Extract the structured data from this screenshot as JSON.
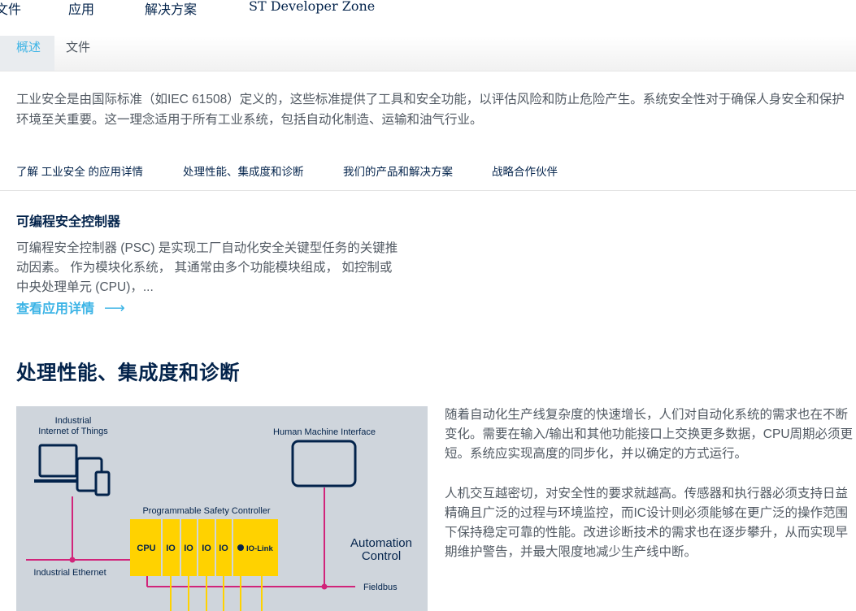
{
  "topnav": {
    "items": [
      "文件",
      "应用",
      "解决方案",
      "ST Developer Zone"
    ]
  },
  "tabs": [
    {
      "label": "概述",
      "active": true
    },
    {
      "label": "文件",
      "active": false
    }
  ],
  "intro": {
    "line1": "工业安全是由国际标准（如IEC 61508）定义的，这些标准提供了工具和安全功能，以评估风险和防止危险产生。系统安全性对于确保人身安全和保护",
    "line2": "环境至关重要。这一理念适用于所有工业系统，包括自动化制造、运输和油气行业。"
  },
  "subnav": {
    "items": [
      "了解 工业安全 的应用详情",
      "处理性能、集成度和诊断",
      "我们的产品和解决方案",
      "战略合作伙伴"
    ]
  },
  "psc": {
    "title": "可编程安全控制器",
    "line1": "可编程安全控制器 (PSC) 是实现工厂自动化安全关键型任务的关键推",
    "line2": "动因素。 作为模块化系统， 其通常由多个功能模块组成， 如控制或",
    "line3": "中央处理单元 (CPU)，...",
    "link": "查看应用详情",
    "link_arrow": "⟶"
  },
  "section": {
    "title": "处理性能、集成度和诊断",
    "p1": [
      "随着自动化生产线复杂度的快速增长，人们对自动化系统的需求也在不断",
      "变化。需要在输入/输出和其他功能接口上交换更多数据，CPU周期必须更",
      "短。系统应实现高度的同步化，并以确定的方式运行。"
    ],
    "p2": [
      "人机交互越密切，对安全性的要求就越高。传感器和执行器必须支持日益",
      "精确且广泛的过程与环境监控，而IC设计则必须能够在更广泛的操作范围",
      "下保持稳定可靠的性能。改进诊断技术的需求也在逐步攀升，从而实现早",
      "期维护警告，并最大限度地减少生产线中断。"
    ]
  },
  "diagram": {
    "iiot_label_1": "Industrial",
    "iiot_label_2": "Internet of Things",
    "hmi_label": "Human Machine Interface",
    "psc_label": "Programmable Safety Controller",
    "modules": [
      "CPU",
      "IO",
      "IO",
      "IO",
      "IO",
      "IO-Link"
    ],
    "automation_1": "Automation",
    "automation_2": "Control",
    "ethernet_label": "Industrial Ethernet",
    "fieldbus_label": "Fieldbus",
    "colors": {
      "background": "#cfd5dc",
      "navy": "#03234b",
      "magenta": "#d1247a",
      "yellow": "#ffd200"
    }
  },
  "colors": {
    "accent": "#3cb4e6",
    "navy": "#03234b",
    "text": "#525a63"
  }
}
